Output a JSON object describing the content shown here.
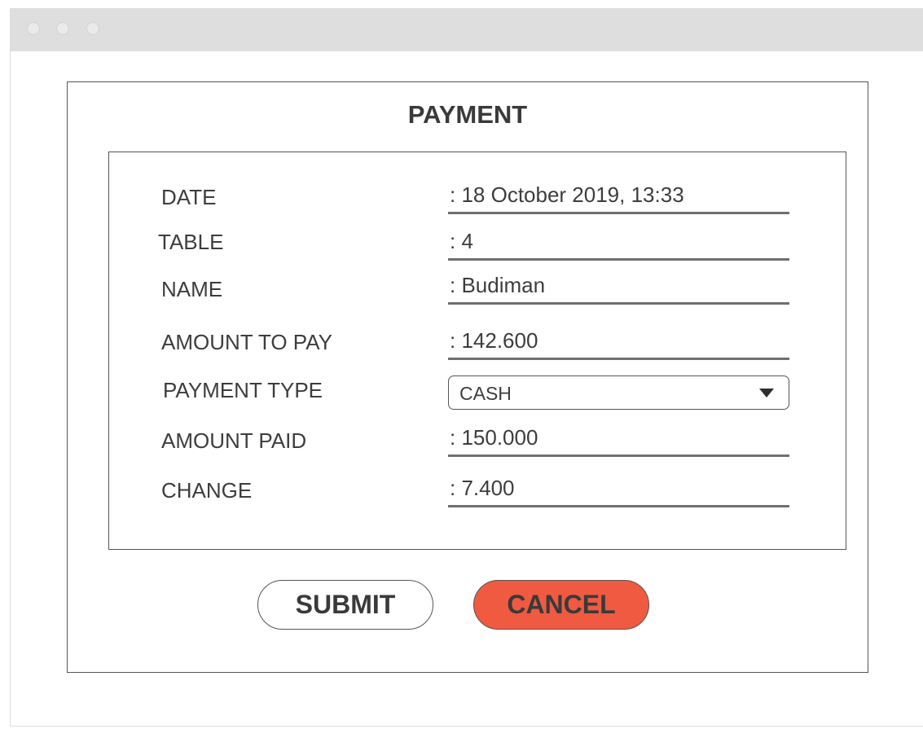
{
  "window": {
    "controls": [
      "window-dot",
      "window-dot",
      "window-dot"
    ]
  },
  "dialog": {
    "title": "PAYMENT",
    "fields": {
      "date": {
        "label": "DATE",
        "value": ": 18 October 2019, 13:33"
      },
      "table": {
        "label": "TABLE",
        "value": ": 4"
      },
      "name": {
        "label": "NAME",
        "value": ": Budiman"
      },
      "amount_to_pay": {
        "label": "AMOUNT TO PAY",
        "value": ": 142.600"
      },
      "payment_type": {
        "label": "PAYMENT TYPE",
        "selected": "CASH"
      },
      "amount_paid": {
        "label": "AMOUNT PAID",
        "value": ": 150.000"
      },
      "change": {
        "label": "CHANGE",
        "value": ": 7.400"
      }
    },
    "buttons": {
      "submit_label": "SUBMIT",
      "cancel_label": "CANCEL"
    }
  },
  "colors": {
    "titlebar": "#dedede",
    "cancel_button": "#f05a41",
    "border": "#555555",
    "text": "#3a3a3a"
  }
}
